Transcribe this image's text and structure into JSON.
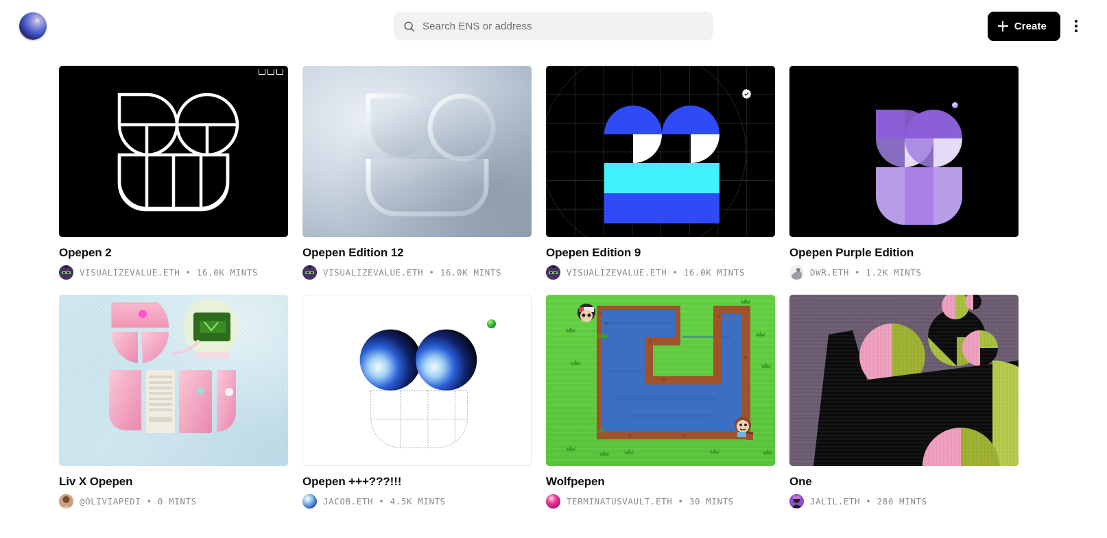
{
  "header": {
    "logo_icon": "sphere-logo",
    "search": {
      "icon": "search-icon",
      "placeholder": "Search ENS or address",
      "value": ""
    },
    "create_label": "Create",
    "create_icon": "plus-icon",
    "menu_icon": "kebab-menu-icon"
  },
  "colors": {
    "accent_black": "#000000",
    "search_bg": "#f2f2f2",
    "meta_text": "#8a8a8a",
    "title_text": "#0d0d0d",
    "blue": "#2f4bf7",
    "cyan": "#3ff2fb",
    "purple": "#8b5fd6",
    "pink": "#f2a0c0",
    "olive": "#a8c23c",
    "green_grass": "#5ec93f",
    "water_blue": "#3a6fc4",
    "rock_brown": "#a0522d"
  },
  "cards": [
    {
      "title": "Opepen 2",
      "artist": "VISUALIZEVALUE.ETH",
      "separator": "•",
      "mints": "16.0K MINTS",
      "art": "outline-opepen-black",
      "badge": null
    },
    {
      "title": "Opepen Edition 12",
      "artist": "VISUALIZEVALUE.ETH",
      "separator": "•",
      "mints": "16.0K MINTS",
      "art": "embossed-3d-opepen",
      "badge": null
    },
    {
      "title": "Opepen Edition 9",
      "artist": "VISUALIZEVALUE.ETH",
      "separator": "•",
      "mints": "16.0K MINTS",
      "art": "blue-cyan-opepen-grid",
      "badge": "verified-seal-icon"
    },
    {
      "title": "Opepen Purple Edition",
      "artist": "DWR.ETH",
      "separator": "•",
      "mints": "1.2K MINTS",
      "art": "purple-opepen",
      "badge": "purple-dot-icon"
    },
    {
      "title": "Liv X Opepen",
      "artist": "@OLIVIAPEDI",
      "separator": "•",
      "mints": "0 MINTS",
      "art": "pink-photo-opepen",
      "badge": null
    },
    {
      "title": "Opepen +++???!!!",
      "artist": "JACOB.ETH",
      "separator": "•",
      "mints": "4.5K MINTS",
      "art": "blue-spheres-dotted-grid",
      "badge": "green-sphere-icon"
    },
    {
      "title": "Wolfpepen",
      "artist": "TERMINATUSVAULT.ETH",
      "separator": "•",
      "mints": "30 MINTS",
      "art": "pixel-game-lake",
      "badge": null
    },
    {
      "title": "One",
      "artist": "JALIL.ETH",
      "separator": "•",
      "mints": "280 MINTS",
      "art": "abstract-geometric",
      "badge": null
    }
  ]
}
